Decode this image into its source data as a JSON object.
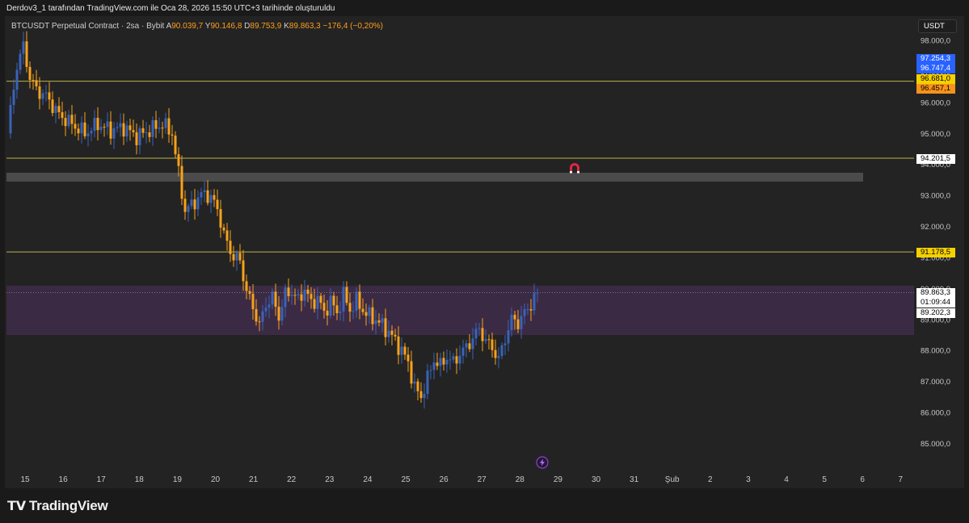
{
  "caption": "Derdov3_1 tarafından TradingView.com ile Oca 28, 2026 15:50 UTC+3 tarihinde oluşturuldu",
  "symbol": {
    "name": "BTCUSDT Perpetual Contract · 2sa · Bybit",
    "o_key": "A",
    "o_val": "90.039,7",
    "h_key": "Y",
    "h_val": "90.146,8",
    "l_key": "D",
    "l_val": "89.753,9",
    "c_key": "K",
    "c_val": "89.863,3",
    "change": "−176,4 (−0,20%)"
  },
  "currency_button": "USDT",
  "brand": "TradingView",
  "price_tags": {
    "t1": "97.254,3",
    "t2": "96.747,4",
    "t3": "96.681,0",
    "t4": "96.457,1",
    "t5": "94.201,5",
    "t6": "91.178,5",
    "t7": "89.863,3",
    "t8": "01:09:44",
    "t9": "89.202,3"
  },
  "colors": {
    "up": "#3a63b8",
    "down": "#f7a21b",
    "level_line": "#b9b34a",
    "purple_zone": "#3b2a44",
    "grey_zone": "#5a5a5a",
    "tag_blue": "#2962ff",
    "tag_yellow": "#f5d000",
    "tag_orange": "#f7931a"
  },
  "chart_data": {
    "type": "candlestick",
    "interval": "2sa",
    "ylim": [
      84500,
      98300
    ],
    "y_ticks": [
      {
        "v": 98000,
        "label": "98.000,0"
      },
      {
        "v": 97000,
        "label": "97.000,0"
      },
      {
        "v": 96000,
        "label": "96.000,0"
      },
      {
        "v": 95000,
        "label": "95.000,0"
      },
      {
        "v": 94000,
        "label": "94.000,0"
      },
      {
        "v": 93000,
        "label": "93.000,0"
      },
      {
        "v": 92000,
        "label": "92.000,0"
      },
      {
        "v": 91000,
        "label": "91.000,0"
      },
      {
        "v": 90000,
        "label": "90.000,0"
      },
      {
        "v": 89000,
        "label": "89.000,0"
      },
      {
        "v": 88000,
        "label": "88.000,0"
      },
      {
        "v": 87000,
        "label": "87.000,0"
      },
      {
        "v": 86000,
        "label": "86.000,0"
      },
      {
        "v": 85000,
        "label": "85.000,0"
      }
    ],
    "x_ticks": [
      "15",
      "16",
      "17",
      "18",
      "19",
      "20",
      "21",
      "22",
      "23",
      "24",
      "25",
      "26",
      "27",
      "28",
      "29",
      "30",
      "31",
      "Şub",
      "2",
      "3",
      "4",
      "5",
      "6",
      "7"
    ],
    "horizontal_levels": [
      96681.0,
      94201.5,
      91178.5
    ],
    "zones": [
      {
        "name": "grey",
        "top": 93800,
        "bottom": 93520
      },
      {
        "name": "purple",
        "top": 90200,
        "bottom": 88600
      }
    ],
    "last_price": 89863.3,
    "anchors": [
      [
        0,
        95000
      ],
      [
        3,
        97200
      ],
      [
        5,
        97800
      ],
      [
        7,
        96800
      ],
      [
        9,
        96400
      ],
      [
        12,
        96200
      ],
      [
        16,
        95600
      ],
      [
        20,
        95300
      ],
      [
        24,
        95000
      ],
      [
        28,
        95300
      ],
      [
        32,
        95100
      ],
      [
        36,
        95200
      ],
      [
        40,
        94900
      ],
      [
        44,
        95100
      ],
      [
        48,
        95300
      ],
      [
        51,
        95000
      ],
      [
        53,
        93700
      ],
      [
        55,
        92500
      ],
      [
        58,
        92800
      ],
      [
        61,
        93100
      ],
      [
        63,
        92900
      ],
      [
        65,
        92600
      ],
      [
        67,
        91700
      ],
      [
        70,
        91000
      ],
      [
        72,
        90900
      ],
      [
        74,
        89900
      ],
      [
        76,
        89400
      ],
      [
        78,
        88800
      ],
      [
        80,
        89500
      ],
      [
        82,
        89700
      ],
      [
        84,
        89100
      ],
      [
        86,
        89800
      ],
      [
        88,
        89900
      ],
      [
        90,
        89600
      ],
      [
        92,
        90000
      ],
      [
        94,
        89500
      ],
      [
        96,
        89700
      ],
      [
        98,
        89200
      ],
      [
        100,
        89600
      ],
      [
        102,
        89200
      ],
      [
        104,
        89800
      ],
      [
        106,
        89300
      ],
      [
        108,
        89600
      ],
      [
        110,
        89300
      ],
      [
        112,
        89100
      ],
      [
        114,
        89000
      ],
      [
        116,
        88800
      ],
      [
        118,
        88600
      ],
      [
        120,
        88300
      ],
      [
        122,
        88000
      ],
      [
        124,
        87600
      ],
      [
        126,
        86800
      ],
      [
        128,
        86500
      ],
      [
        130,
        87100
      ],
      [
        132,
        87700
      ],
      [
        134,
        87500
      ],
      [
        136,
        87800
      ],
      [
        138,
        87600
      ],
      [
        140,
        87900
      ],
      [
        142,
        88100
      ],
      [
        144,
        88400
      ],
      [
        146,
        88700
      ],
      [
        148,
        88300
      ],
      [
        150,
        88100
      ],
      [
        152,
        87700
      ],
      [
        154,
        88400
      ],
      [
        156,
        89000
      ],
      [
        158,
        88900
      ],
      [
        160,
        89200
      ],
      [
        162,
        89500
      ],
      [
        164,
        89863
      ]
    ]
  }
}
